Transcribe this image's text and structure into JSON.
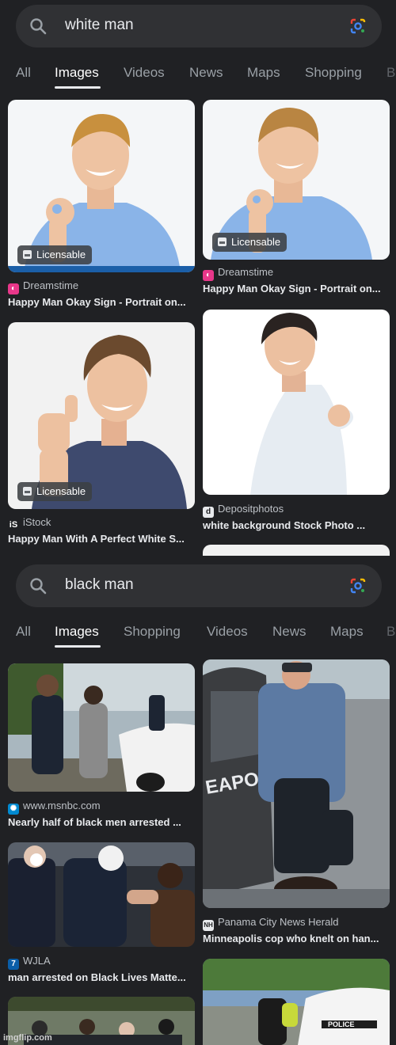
{
  "search1": {
    "query": "white man",
    "tabs": [
      "All",
      "Images",
      "Videos",
      "News",
      "Maps",
      "Shopping",
      "B"
    ],
    "active_tab": "Images",
    "results": [
      {
        "source": "Dreamstime",
        "title": "Happy Man Okay Sign - Portrait on...",
        "badge": "Licensable",
        "favicon": "dreamstime-icon"
      },
      {
        "source": "Dreamstime",
        "title": "Happy Man Okay Sign - Portrait on...",
        "badge": "Licensable",
        "favicon": "dreamstime-icon"
      },
      {
        "source": "iStock",
        "title": "Happy Man With A Perfect White S...",
        "badge": "Licensable",
        "favicon": "istock-icon",
        "fav_text": "iS"
      },
      {
        "source": "Depositphotos",
        "title": "white background Stock Photo ...",
        "favicon": "depositphotos-icon",
        "fav_text": "d"
      }
    ]
  },
  "search2": {
    "query": "black man",
    "tabs": [
      "All",
      "Images",
      "Shopping",
      "Videos",
      "News",
      "Maps",
      "B"
    ],
    "active_tab": "Images",
    "results": [
      {
        "source": "www.msnbc.com",
        "title": "Nearly half of black men arrested ...",
        "favicon": "msnbc-icon"
      },
      {
        "source": "Panama City News Herald",
        "title": "Minneapolis cop who knelt on han...",
        "favicon": "news-herald-icon",
        "fav_text": "NH"
      },
      {
        "source": "WJLA",
        "title": "man arrested on Black Lives Matte...",
        "favicon": "wjla-icon",
        "fav_text": "7"
      }
    ]
  },
  "watermark": "imgflip.com",
  "colors": {
    "background": "#202124",
    "searchbar": "#303134",
    "badge": "#3c4043"
  }
}
